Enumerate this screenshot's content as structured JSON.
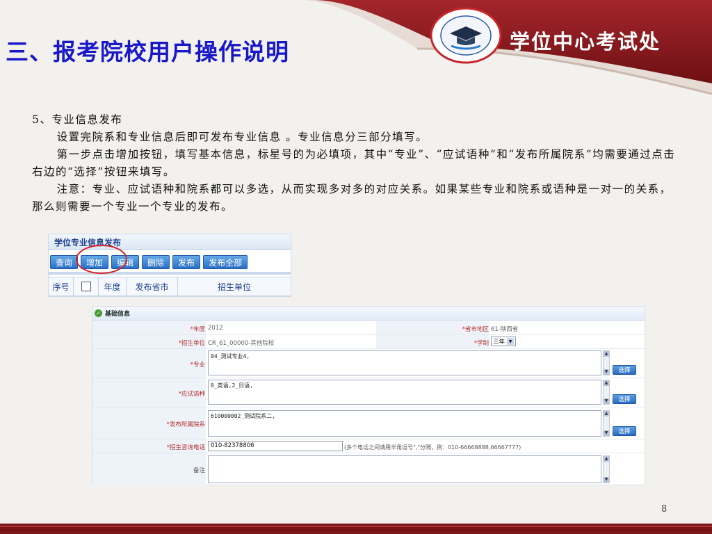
{
  "header": {
    "title": "三、报考院校用户操作说明",
    "org_name": "学位中心考试处",
    "seal_text": "教育部学位与研究生教育发展中心",
    "colors": {
      "banner": "#8b1a1f",
      "title": "#1818c8"
    }
  },
  "content": {
    "heading": "5、专业信息发布",
    "para1": "设置完院系和专业信息后即可发布专业信息 。专业信息分三部分填写。",
    "para2": "第一步点击增加按钮，填写基本信息，标星号的为必填项，其中“专业”、“应试语种”和“发布所属院系”均需要通过点击右边的“选择”按钮来填写。",
    "para3": "注意：专业、应试语种和院系都可以多选，从而实现多对多的对应关系。如果某些专业和院系或语种是一对一的关系，那么则需要一个专业一个专业的发布。"
  },
  "toolbar": {
    "title": "学位专业信息发布",
    "buttons": [
      "查询",
      "增加",
      "编辑",
      "删除",
      "发布",
      "发布全部"
    ],
    "columns": [
      "序号",
      "",
      "年度",
      "发布省市",
      "招生单位"
    ]
  },
  "form": {
    "section_title": "基础信息",
    "year_label": "年度",
    "year_value": "2012",
    "region_label": "省市地区",
    "region_value": "61-陕西省",
    "unit_label": "招生单位",
    "unit_value": "CR_61_00000-其他院校",
    "duration_label": "学制",
    "duration_value": "三年",
    "major_label": "专业",
    "major_value": "04_测试专业4,",
    "lang_label": "应试语种",
    "lang_value": "0_英语,2_日语,",
    "dept_label": "发布所属院系",
    "dept_value": "610000002_测试院系二,",
    "phone_label": "招生咨询电话",
    "phone_value": "010-82378806",
    "phone_hint": "(多个电话之间请用半角逗号\",\"分隔，例：010-66668888,66667777)",
    "note_label": "备注",
    "select_label": "选择",
    "star": "*"
  },
  "footer": {
    "page_number": "8"
  }
}
